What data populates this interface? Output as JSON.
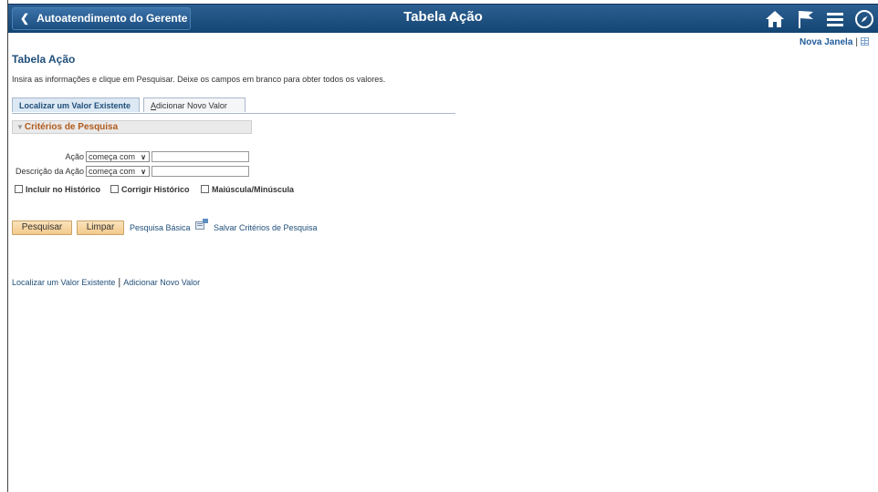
{
  "header": {
    "back_label": "Autoatendimento do Gerente",
    "title": "Tabela Ação",
    "icons": [
      "home-icon",
      "flag-icon",
      "menu-icon",
      "compass-icon"
    ]
  },
  "toolbar": {
    "new_window": "Nova Janela",
    "separator": "|",
    "icon": "grid-icon"
  },
  "page": {
    "title": "Tabela Ação",
    "instructions": "Insira as informações e clique em Pesquisar. Deixe os campos em branco para obter todos os valores."
  },
  "tabs": [
    {
      "label": "Localizar um Valor Existente",
      "active": true
    },
    {
      "label_first": "A",
      "label_rest": "dicionar Novo Valor",
      "active": false
    }
  ],
  "criteria": {
    "header": "Critérios de Pesquisa",
    "fields": [
      {
        "label": "Ação",
        "operator": "começa com",
        "value": ""
      },
      {
        "label": "Descrição da Ação",
        "operator": "começa com",
        "value": ""
      }
    ],
    "checkboxes": [
      {
        "label": "Incluir no Histórico",
        "checked": false
      },
      {
        "label": "Corrigir Histórico",
        "checked": false
      },
      {
        "label": "Maiúscula/Minúscula",
        "checked": false
      }
    ]
  },
  "actions": {
    "search": "Pesquisar",
    "clear": "Limpar",
    "basic_search": "Pesquisa Básica",
    "save_criteria": "Salvar Critérios de Pesquisa"
  },
  "footer_links": {
    "find": "Localizar um Valor Existente",
    "separator": "|",
    "add": "Adicionar Novo Valor"
  },
  "colors": {
    "header_bg": "#1d5083",
    "link": "#1f4e79",
    "criteria_title": "#b05a1a",
    "button_bg": "#f3c98c"
  }
}
